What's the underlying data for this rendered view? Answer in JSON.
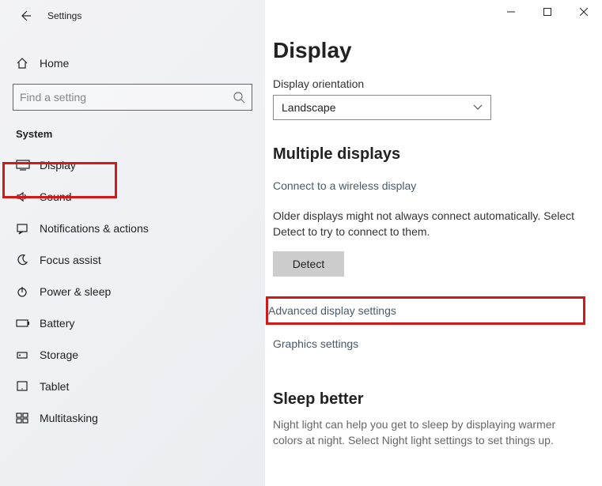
{
  "window_title": "Settings",
  "home_label": "Home",
  "search_placeholder": "Find a setting",
  "category_label": "System",
  "sidebar": {
    "items": [
      {
        "label": "Display"
      },
      {
        "label": "Sound"
      },
      {
        "label": "Notifications & actions"
      },
      {
        "label": "Focus assist"
      },
      {
        "label": "Power & sleep"
      },
      {
        "label": "Battery"
      },
      {
        "label": "Storage"
      },
      {
        "label": "Tablet"
      },
      {
        "label": "Multitasking"
      }
    ]
  },
  "content": {
    "page_title": "Display",
    "orientation_label": "Display orientation",
    "orientation_value": "Landscape",
    "multi_title": "Multiple displays",
    "wireless_link": "Connect to a wireless display",
    "detect_hint": "Older displays might not always connect automatically. Select Detect to try to connect to them.",
    "detect_button": "Detect",
    "advanced_link": "Advanced display settings",
    "graphics_link": "Graphics settings",
    "sleep_title": "Sleep better",
    "sleep_text": "Night light can help you get to sleep by displaying warmer colors at night. Select Night light settings to set things up."
  }
}
